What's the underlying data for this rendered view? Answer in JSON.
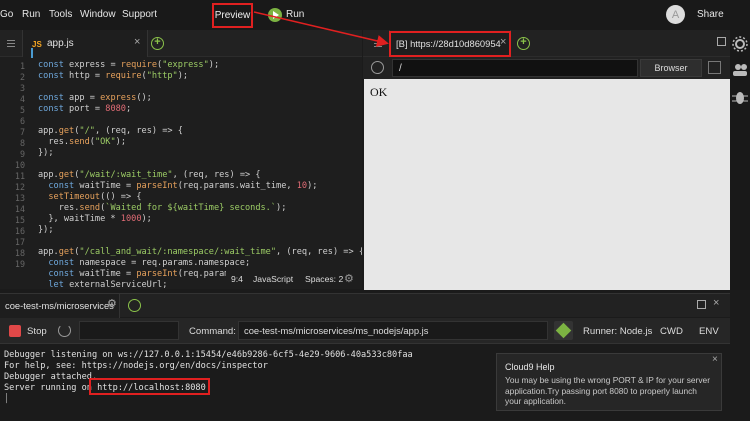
{
  "menubar": {
    "items": [
      "Go",
      "Run",
      "Tools",
      "Window",
      "Support"
    ],
    "preview_label": "Preview",
    "run_label": "Run",
    "avatar_letter": "A",
    "share_label": "Share"
  },
  "editor": {
    "tab_badge": "JS",
    "tab_label": "app.js",
    "line_numbers": [
      "1",
      "2",
      "3",
      "4",
      "5",
      "6",
      "7",
      "8",
      "9",
      "10",
      "11",
      "12",
      "13",
      "14",
      "15",
      "16",
      "17",
      "18",
      "19"
    ],
    "status": {
      "cursor": "9:4",
      "language": "JavaScript",
      "spaces": "Spaces: 2"
    }
  },
  "preview": {
    "tab_label": "[B] https://28d10d860954",
    "url_value": "/",
    "browser_label": "Browser",
    "body_text": "OK"
  },
  "terminal": {
    "tab_label": "coe-test-ms/microservices",
    "stop_label": "Stop",
    "command_label": "Command:",
    "command_value": "coe-test-ms/microservices/ms_nodejs/app.js",
    "runner_label": "Runner: Node.js",
    "cwd_label": "CWD",
    "env_label": "ENV",
    "lines": [
      "Debugger listening on ws://127.0.0.1:15454/e46b9286-6cf5-4e29-9606-40a533c80faa",
      "For help, see: https://nodejs.org/en/docs/inspector",
      "Debugger attached.",
      "Server running on http://localhost:8080"
    ]
  },
  "help": {
    "title": "Cloud9 Help",
    "text": "You may be using the wrong PORT & IP for your server application.Try passing port 8080 to properly launch your application."
  },
  "colors": {
    "annotation": "#e02020",
    "accent_green": "#7cb342"
  }
}
